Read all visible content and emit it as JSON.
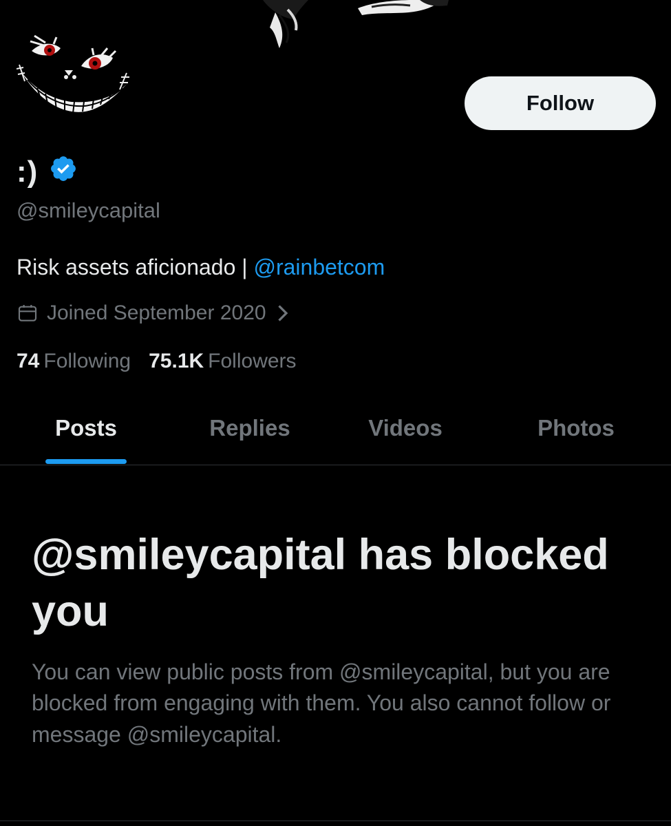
{
  "profile": {
    "display_name": ":)",
    "handle": "@smileycapital",
    "bio_text": "Risk assets aficionado | ",
    "bio_link": "@rainbetcom",
    "joined": "Joined September 2020",
    "following_count": "74",
    "following_label": "Following",
    "followers_count": "75.1K",
    "followers_label": "Followers",
    "follow_button": "Follow"
  },
  "tabs": [
    {
      "label": "Posts",
      "active": true
    },
    {
      "label": "Replies",
      "active": false
    },
    {
      "label": "Videos",
      "active": false
    },
    {
      "label": "Photos",
      "active": false
    }
  ],
  "blocked": {
    "title": "@smileycapital has blocked you",
    "body": "You can view public posts from @smileycapital, but you are blocked from engaging with them. You also cannot follow or message @smileycapital."
  },
  "colors": {
    "background": "#000000",
    "primary_text": "#e7e9ea",
    "secondary_text": "#71767b",
    "accent": "#1d9bf0",
    "verified_badge": "#1d9bf0",
    "follow_button_bg": "#eff3f4"
  },
  "icons": {
    "verified": "verified-badge-icon",
    "calendar": "calendar-icon",
    "chevron": "chevron-right-icon"
  }
}
